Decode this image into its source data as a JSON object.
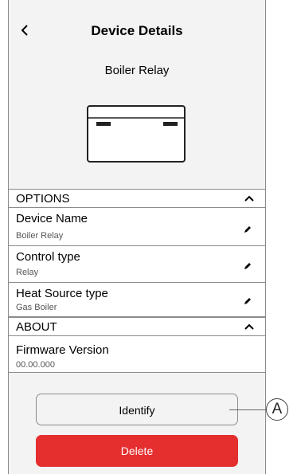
{
  "header": {
    "title": "Device Details",
    "back_icon": "chevron-left-icon"
  },
  "device": {
    "name": "Boiler Relay",
    "image_icon": "relay-device-icon"
  },
  "options_section": {
    "label": "OPTIONS",
    "rows": [
      {
        "title": "Device Name",
        "value": "Boiler Relay"
      },
      {
        "title": "Control type",
        "value": "Relay"
      },
      {
        "title": "Heat Source type",
        "value": "Gas Boiler"
      }
    ]
  },
  "about_section": {
    "label": "ABOUT",
    "firmware": {
      "title": "Firmware Version",
      "value": "00.00.000"
    }
  },
  "buttons": {
    "identify": "Identify",
    "delete": "Delete"
  },
  "callout": {
    "label": "A"
  },
  "colors": {
    "delete": "#e52e2e",
    "panel": "#f3f3f3"
  }
}
